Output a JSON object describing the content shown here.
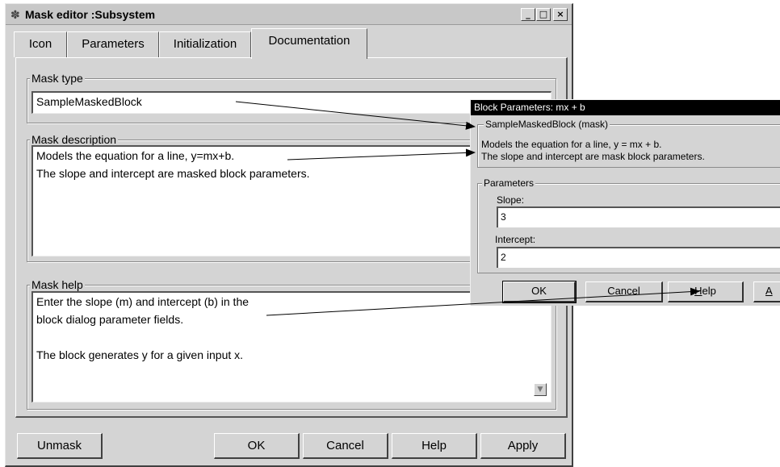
{
  "window": {
    "title": "Mask editor :Subsystem",
    "minimize_glyph": "_",
    "maximize_glyph": "□",
    "close_glyph": "×"
  },
  "tabs": [
    {
      "label": "Icon",
      "active": false
    },
    {
      "label": "Parameters",
      "active": false
    },
    {
      "label": "Initialization",
      "active": false
    },
    {
      "label": "Documentation",
      "active": true
    }
  ],
  "mask_type": {
    "label": "Mask type",
    "value": "SampleMaskedBlock"
  },
  "mask_description": {
    "label": "Mask description",
    "lines": [
      "Models the equation for a line, y=mx+b.",
      "The slope and intercept are masked block parameters."
    ]
  },
  "mask_help": {
    "label": "Mask help",
    "lines": [
      "Enter the slope (m) and intercept (b) in the",
      "block dialog parameter fields.",
      "",
      "The block generates y for a given input x."
    ]
  },
  "buttons": {
    "unmask": "Unmask",
    "ok": "OK",
    "cancel": "Cancel",
    "help": "Help",
    "apply": "Apply"
  },
  "block_params": {
    "title": "Block Parameters: mx + b",
    "group_label": "SampleMaskedBlock (mask)",
    "description_lines": [
      "Models the equation for a line, y = mx + b.",
      "The slope and intercept are mask block parameters."
    ],
    "parameters_label": "Parameters",
    "slope_label": "Slope:",
    "slope_value": "3",
    "intercept_label": "Intercept:",
    "intercept_value": "2",
    "ok": "OK",
    "cancel": "Cancel",
    "help_first": "H",
    "help_rest": "elp",
    "apply_partial": "A"
  },
  "colors": {
    "window_face": "#d4d4d4",
    "param_titlebar": "#000000",
    "field_background": "#ffffff"
  }
}
